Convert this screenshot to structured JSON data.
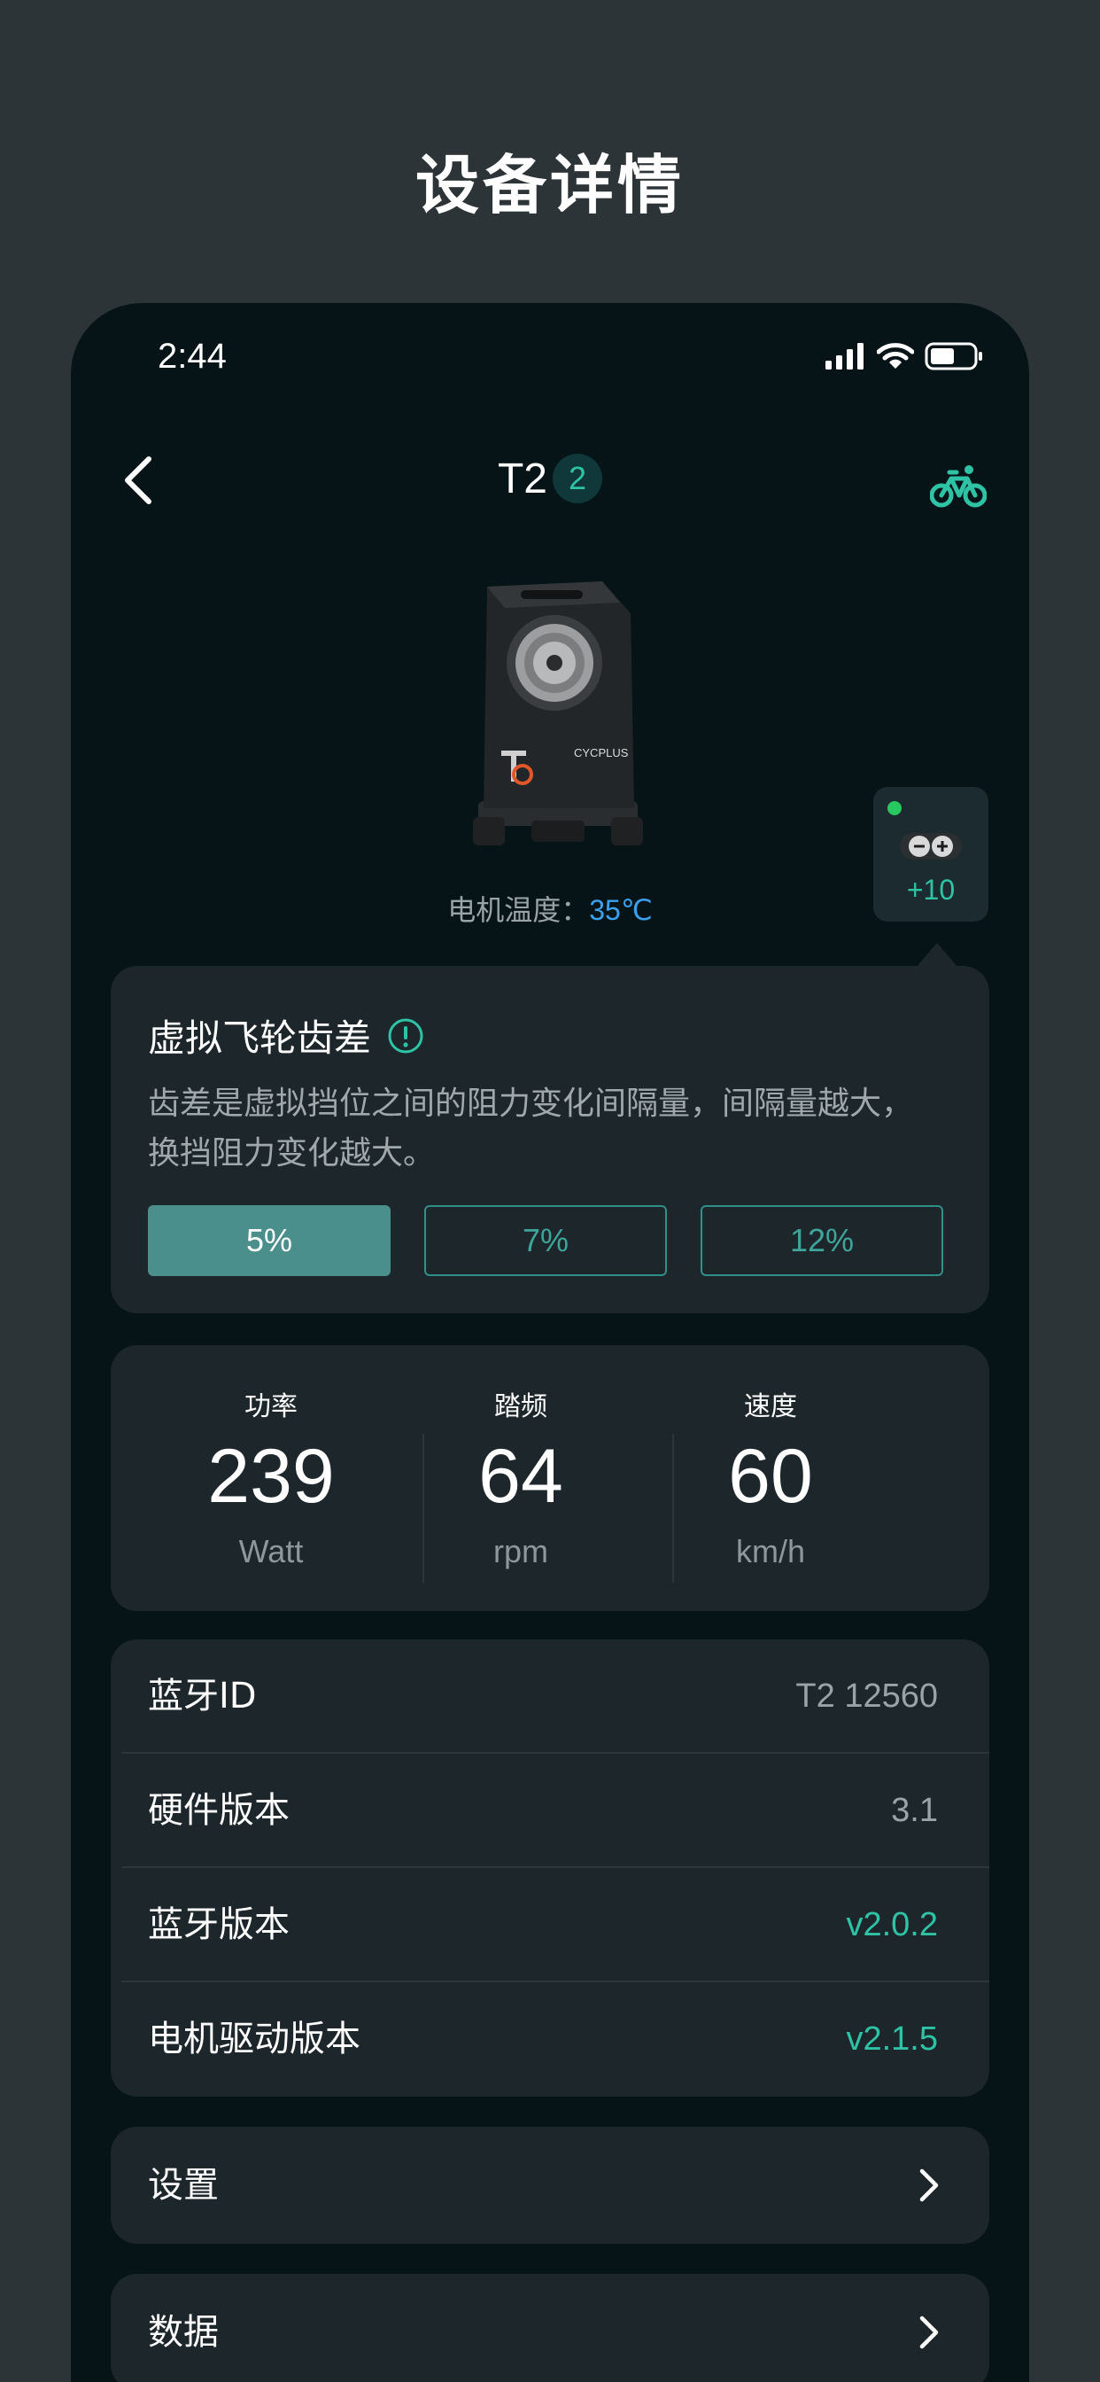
{
  "page_heading": "设备详情",
  "status_bar": {
    "time": "2:44"
  },
  "nav": {
    "title": "T2",
    "badge": "2"
  },
  "device": {
    "temperature_label": "电机温度：",
    "temperature_value": "35℃",
    "image_brand": "CYCPLUS"
  },
  "shifter": {
    "level_display": "+10",
    "status_color": "#28c860"
  },
  "gear_ratio": {
    "title": "虚拟飞轮齿差",
    "info_icon": "info-circle-icon",
    "description": "齿差是虚拟挡位之间的阻力变化间隔量，间隔量越大，换挡阻力变化越大。",
    "options": [
      "5%",
      "7%",
      "12%"
    ],
    "selected_option": "5%"
  },
  "metrics": [
    {
      "label": "功率",
      "value": "239",
      "unit": "Watt"
    },
    {
      "label": "踏频",
      "value": "64",
      "unit": "rpm"
    },
    {
      "label": "速度",
      "value": "60",
      "unit": "km/h"
    }
  ],
  "info": [
    {
      "label": "蓝牙ID",
      "value": "T2 12560"
    },
    {
      "label": "硬件版本",
      "value": "3.1"
    },
    {
      "label": "蓝牙版本",
      "value": "v2.0.2"
    },
    {
      "label": "电机驱动版本",
      "value": "v2.1.5"
    }
  ],
  "links": {
    "settings": "设置",
    "data": "数据"
  },
  "colors": {
    "accent": "#2fc3a6",
    "temperature": "#3aa0f0",
    "selected_option": "#4a8f8c",
    "card_background": "#1d262b",
    "screen_background": "#061418"
  }
}
